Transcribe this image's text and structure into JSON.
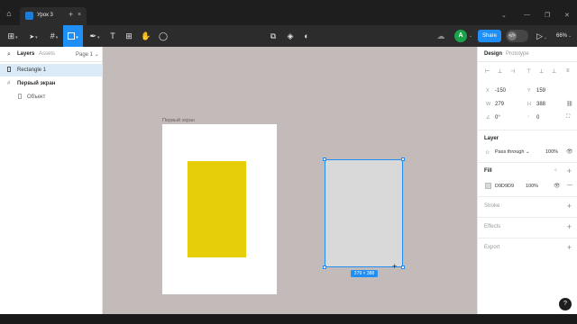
{
  "titlebar": {
    "home_icon": "home-icon",
    "tab_title": "Урок 3",
    "tab_close": "×",
    "tab_add": "+",
    "win_chevron": "⌄",
    "win_min": "—",
    "win_max": "❐",
    "win_close": "✕"
  },
  "toolbar": {
    "main_menu": "⊞",
    "move_tool": "➤",
    "frame_tool": "#",
    "pen_tool": "✒",
    "text_tool": "T",
    "resources_tool": "⊞",
    "hand_tool": "✋",
    "comment_tool": "◯",
    "crop": "⧉",
    "component": "◈",
    "contrast": "◐",
    "cloud": "☁",
    "avatar_letter": "A",
    "avatar_caret": "⌄",
    "share_label": "Share",
    "dev_label": "</>",
    "play": "▷",
    "play_caret": "⌄",
    "zoom_label": "66%",
    "zoom_caret": "⌄"
  },
  "layers_panel": {
    "search_icon": "⌕",
    "tabs": [
      "Layers",
      "Assets"
    ],
    "page_label": "Page 1",
    "page_caret": "⌄",
    "items": [
      {
        "name": "Rectangle 1",
        "selected": true,
        "icon": "rectangle-layer-icon"
      },
      {
        "name": "Первый экран",
        "selected": false,
        "icon": "frame-layer-icon"
      },
      {
        "name": "Объект",
        "selected": false,
        "icon": "rectangle-layer-icon"
      }
    ]
  },
  "canvas": {
    "frame_label": "Первый экран",
    "selection_size": "279 × 388",
    "frame_color": "#ffffff",
    "object_color": "#E6CF0A",
    "selected_fill": "#D9D9D9",
    "selection_color": "#1F8FF5",
    "background": "#C2BBB9"
  },
  "design_panel": {
    "tabs": [
      "Design",
      "Prototype"
    ],
    "x_label": "X",
    "x_value": "-150",
    "y_label": "Y",
    "y_value": "159",
    "w_label": "W",
    "w_value": "279",
    "h_label": "H",
    "h_value": "388",
    "rotation_value": "0°",
    "radius_value": "0",
    "layer_section": "Layer",
    "blend_mode": "Pass through",
    "blend_caret": "⌄",
    "layer_opacity": "100%",
    "fill_section": "Fill",
    "fill_hex": "D9D9D9",
    "fill_opacity": "100%",
    "fill_remove": "—",
    "stroke_section": "Stroke",
    "effects_section": "Effects",
    "export_section": "Export",
    "plus": "+"
  },
  "help_label": "?"
}
